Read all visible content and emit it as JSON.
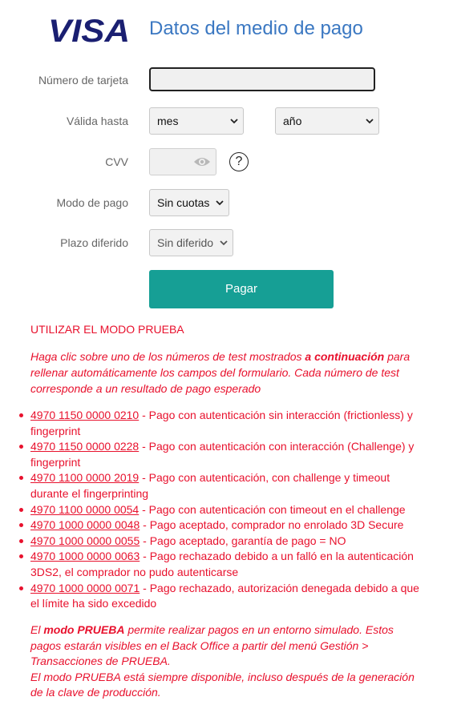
{
  "header": {
    "brand": "VISA",
    "title": "Datos del medio de pago"
  },
  "form": {
    "card_number_label": "Número de tarjeta",
    "card_number_value": "",
    "expiry_label": "Válida hasta",
    "month_value": "mes",
    "year_value": "año",
    "cvv_label": "CVV",
    "cvv_value": "",
    "cvv_help": "?",
    "payment_mode_label": "Modo de pago",
    "payment_mode_value": "Sin cuotas",
    "deferred_label": "Plazo diferido",
    "deferred_value": "Sin diferido",
    "pay_button": "Pagar"
  },
  "test_mode": {
    "heading": "UTILIZAR EL MODO PRUEBA",
    "intro_before": "Haga clic sobre uno de los números de test mostrados ",
    "intro_bold": "a continuación",
    "intro_after": " para rellenar automáticamente los campos del formulario. Cada número de test corresponde a un resultado de pago esperado",
    "cards": [
      {
        "number": "4970 1150 0000 0210",
        "description": " - Pago con autenticación sin interacción (frictionless) y fingerprint"
      },
      {
        "number": "4970 1150 0000 0228",
        "description": " - Pago con autenticación con interacción (Challenge) y fingerprint"
      },
      {
        "number": "4970 1100 0000 2019",
        "description": " - Pago con autenticación, con challenge y timeout durante el fingerprinting"
      },
      {
        "number": "4970 1100 0000 0054",
        "description": " - Pago con autenticación con timeout en el challenge"
      },
      {
        "number": "4970 1000 0000 0048",
        "description": " - Pago aceptado, comprador no enrolado 3D Secure"
      },
      {
        "number": "4970 1000 0000 0055",
        "description": " - Pago aceptado, garantía de pago = NO"
      },
      {
        "number": "4970 1000 0000 0063",
        "description": " - Pago rechazado debido a un falló en la autenticación 3DS2, el comprador no pudo autenticarse"
      },
      {
        "number": "4970 1000 0000 0071",
        "description": " - Pago rechazado, autorización denegada debido a que el límite ha sido excedido"
      }
    ],
    "note_before": "El ",
    "note_bold": "modo PRUEBA",
    "note_after": " permite realizar pagos en un entorno simulado. Estos pagos estarán visibles en el Back Office a partir del menú Gestión > Transacciones de PRUEBA.",
    "note_line2": "El modo PRUEBA está siempre disponible, incluso después de la generación de la clave de producción."
  },
  "colors": {
    "visa_blue": "#1a1f71",
    "title_blue": "#3b78c2",
    "pay_button": "#169f95",
    "test_red": "#e8112d"
  },
  "icons": {
    "cvv_toggle": "eye-icon",
    "help": "question-circle-icon",
    "select": "chevron-down-icon"
  }
}
